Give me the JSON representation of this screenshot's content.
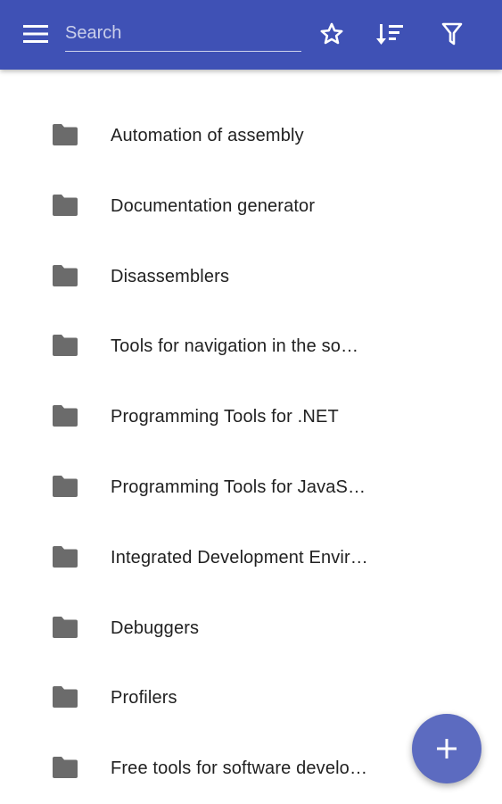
{
  "colors": {
    "app_bar": "#3f51b5",
    "fab": "#5c6bc0",
    "folder_icon": "#6b6b6b",
    "text": "#212121"
  },
  "toolbar": {
    "menu_icon": "hamburger-menu-icon",
    "search_placeholder": "Search",
    "search_value": "",
    "actions": [
      {
        "icon": "star-outline-icon"
      },
      {
        "icon": "sort-icon"
      },
      {
        "icon": "filter-icon"
      }
    ]
  },
  "folders": [
    {
      "icon": "folder-icon",
      "label": "Automation of assembly"
    },
    {
      "icon": "folder-icon",
      "label": "Documentation generator"
    },
    {
      "icon": "folder-icon",
      "label": "Disassemblers"
    },
    {
      "icon": "folder-icon",
      "label": "Tools for navigation in the so…"
    },
    {
      "icon": "folder-icon",
      "label": "Programming Tools for .NET"
    },
    {
      "icon": "folder-icon",
      "label": "Programming Tools for JavaS…"
    },
    {
      "icon": "folder-icon",
      "label": "Integrated Development Envir…"
    },
    {
      "icon": "folder-icon",
      "label": "Debuggers"
    },
    {
      "icon": "folder-icon",
      "label": "Profilers"
    },
    {
      "icon": "folder-icon",
      "label": "Free tools for software develo…"
    }
  ],
  "fab": {
    "icon": "plus-icon"
  }
}
